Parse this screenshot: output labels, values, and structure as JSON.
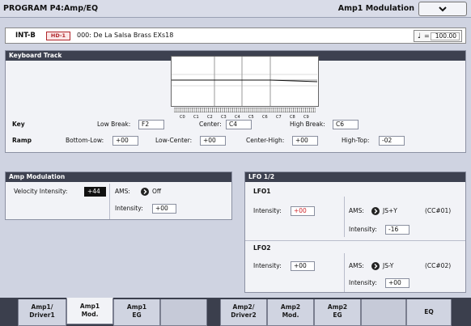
{
  "header": {
    "title": "PROGRAM P4:Amp/EQ",
    "page_name": "Amp1 Modulation",
    "menu_icon": "chevron-down-icon"
  },
  "program": {
    "bank": "INT-B",
    "hd_badge": "HD-1",
    "name": "000: De La Salsa Brass EXs18",
    "tempo_symbol": "♩",
    "tempo_eq": "=",
    "tempo": "100.00"
  },
  "keyboard_track": {
    "title": "Keyboard Track",
    "octaves": [
      "C0",
      "C1",
      "C2",
      "C3",
      "C4",
      "C5",
      "C6",
      "C7",
      "C8",
      "C9"
    ],
    "key_label": "Key",
    "low_break_label": "Low Break:",
    "low_break": "F2",
    "center_label": "Center:",
    "center": "C4",
    "high_break_label": "High Break:",
    "high_break": "C6",
    "ramp_label": "Ramp",
    "bottom_low_label": "Bottom-Low:",
    "bottom_low": "+00",
    "low_center_label": "Low-Center:",
    "low_center": "+00",
    "center_high_label": "Center-High:",
    "center_high": "+00",
    "high_top_label": "High-Top:",
    "high_top": "-02"
  },
  "amp_mod": {
    "title": "Amp Modulation",
    "velocity_label": "Velocity Intensity:",
    "velocity": "+44",
    "ams_label": "AMS:",
    "ams": "Off",
    "intensity_label": "Intensity:",
    "intensity": "+00"
  },
  "lfo": {
    "title": "LFO 1/2",
    "lfo1": {
      "label": "LFO1",
      "intensity_label": "Intensity:",
      "intensity": "+00",
      "ams_label": "AMS:",
      "ams": "JS+Y",
      "cc": "(CC#01)",
      "ams_int_label": "Intensity:",
      "ams_int": "-16"
    },
    "lfo2": {
      "label": "LFO2",
      "intensity_label": "Intensity:",
      "intensity": "+00",
      "ams_label": "AMS:",
      "ams": "JS-Y",
      "cc": "(CC#02)",
      "ams_int_label": "Intensity:",
      "ams_int": "+00"
    }
  },
  "tabs": [
    {
      "l1": "Amp1/",
      "l2": "Driver1"
    },
    {
      "l1": "Amp1",
      "l2": "Mod."
    },
    {
      "l1": "Amp1",
      "l2": "EG"
    },
    {
      "l1": "",
      "l2": ""
    },
    {
      "l1": "Amp2/",
      "l2": "Driver2"
    },
    {
      "l1": "Amp2",
      "l2": "Mod."
    },
    {
      "l1": "Amp2",
      "l2": "EG"
    },
    {
      "l1": "",
      "l2": ""
    },
    {
      "l1": "EQ",
      "l2": ""
    }
  ]
}
